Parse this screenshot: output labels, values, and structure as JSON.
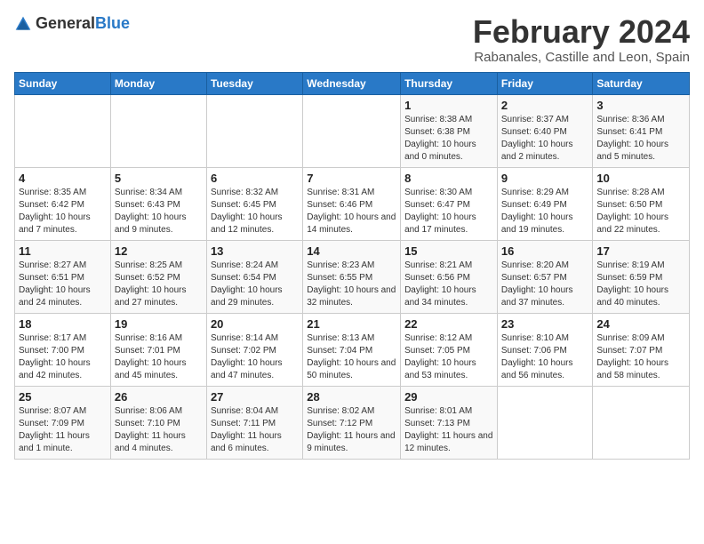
{
  "header": {
    "logo_general": "General",
    "logo_blue": "Blue",
    "month": "February 2024",
    "location": "Rabanales, Castille and Leon, Spain"
  },
  "calendar": {
    "days_of_week": [
      "Sunday",
      "Monday",
      "Tuesday",
      "Wednesday",
      "Thursday",
      "Friday",
      "Saturday"
    ],
    "weeks": [
      [
        {
          "day": "",
          "info": ""
        },
        {
          "day": "",
          "info": ""
        },
        {
          "day": "",
          "info": ""
        },
        {
          "day": "",
          "info": ""
        },
        {
          "day": "1",
          "info": "Sunrise: 8:38 AM\nSunset: 6:38 PM\nDaylight: 10 hours and 0 minutes."
        },
        {
          "day": "2",
          "info": "Sunrise: 8:37 AM\nSunset: 6:40 PM\nDaylight: 10 hours and 2 minutes."
        },
        {
          "day": "3",
          "info": "Sunrise: 8:36 AM\nSunset: 6:41 PM\nDaylight: 10 hours and 5 minutes."
        }
      ],
      [
        {
          "day": "4",
          "info": "Sunrise: 8:35 AM\nSunset: 6:42 PM\nDaylight: 10 hours and 7 minutes."
        },
        {
          "day": "5",
          "info": "Sunrise: 8:34 AM\nSunset: 6:43 PM\nDaylight: 10 hours and 9 minutes."
        },
        {
          "day": "6",
          "info": "Sunrise: 8:32 AM\nSunset: 6:45 PM\nDaylight: 10 hours and 12 minutes."
        },
        {
          "day": "7",
          "info": "Sunrise: 8:31 AM\nSunset: 6:46 PM\nDaylight: 10 hours and 14 minutes."
        },
        {
          "day": "8",
          "info": "Sunrise: 8:30 AM\nSunset: 6:47 PM\nDaylight: 10 hours and 17 minutes."
        },
        {
          "day": "9",
          "info": "Sunrise: 8:29 AM\nSunset: 6:49 PM\nDaylight: 10 hours and 19 minutes."
        },
        {
          "day": "10",
          "info": "Sunrise: 8:28 AM\nSunset: 6:50 PM\nDaylight: 10 hours and 22 minutes."
        }
      ],
      [
        {
          "day": "11",
          "info": "Sunrise: 8:27 AM\nSunset: 6:51 PM\nDaylight: 10 hours and 24 minutes."
        },
        {
          "day": "12",
          "info": "Sunrise: 8:25 AM\nSunset: 6:52 PM\nDaylight: 10 hours and 27 minutes."
        },
        {
          "day": "13",
          "info": "Sunrise: 8:24 AM\nSunset: 6:54 PM\nDaylight: 10 hours and 29 minutes."
        },
        {
          "day": "14",
          "info": "Sunrise: 8:23 AM\nSunset: 6:55 PM\nDaylight: 10 hours and 32 minutes."
        },
        {
          "day": "15",
          "info": "Sunrise: 8:21 AM\nSunset: 6:56 PM\nDaylight: 10 hours and 34 minutes."
        },
        {
          "day": "16",
          "info": "Sunrise: 8:20 AM\nSunset: 6:57 PM\nDaylight: 10 hours and 37 minutes."
        },
        {
          "day": "17",
          "info": "Sunrise: 8:19 AM\nSunset: 6:59 PM\nDaylight: 10 hours and 40 minutes."
        }
      ],
      [
        {
          "day": "18",
          "info": "Sunrise: 8:17 AM\nSunset: 7:00 PM\nDaylight: 10 hours and 42 minutes."
        },
        {
          "day": "19",
          "info": "Sunrise: 8:16 AM\nSunset: 7:01 PM\nDaylight: 10 hours and 45 minutes."
        },
        {
          "day": "20",
          "info": "Sunrise: 8:14 AM\nSunset: 7:02 PM\nDaylight: 10 hours and 47 minutes."
        },
        {
          "day": "21",
          "info": "Sunrise: 8:13 AM\nSunset: 7:04 PM\nDaylight: 10 hours and 50 minutes."
        },
        {
          "day": "22",
          "info": "Sunrise: 8:12 AM\nSunset: 7:05 PM\nDaylight: 10 hours and 53 minutes."
        },
        {
          "day": "23",
          "info": "Sunrise: 8:10 AM\nSunset: 7:06 PM\nDaylight: 10 hours and 56 minutes."
        },
        {
          "day": "24",
          "info": "Sunrise: 8:09 AM\nSunset: 7:07 PM\nDaylight: 10 hours and 58 minutes."
        }
      ],
      [
        {
          "day": "25",
          "info": "Sunrise: 8:07 AM\nSunset: 7:09 PM\nDaylight: 11 hours and 1 minute."
        },
        {
          "day": "26",
          "info": "Sunrise: 8:06 AM\nSunset: 7:10 PM\nDaylight: 11 hours and 4 minutes."
        },
        {
          "day": "27",
          "info": "Sunrise: 8:04 AM\nSunset: 7:11 PM\nDaylight: 11 hours and 6 minutes."
        },
        {
          "day": "28",
          "info": "Sunrise: 8:02 AM\nSunset: 7:12 PM\nDaylight: 11 hours and 9 minutes."
        },
        {
          "day": "29",
          "info": "Sunrise: 8:01 AM\nSunset: 7:13 PM\nDaylight: 11 hours and 12 minutes."
        },
        {
          "day": "",
          "info": ""
        },
        {
          "day": "",
          "info": ""
        }
      ]
    ]
  }
}
